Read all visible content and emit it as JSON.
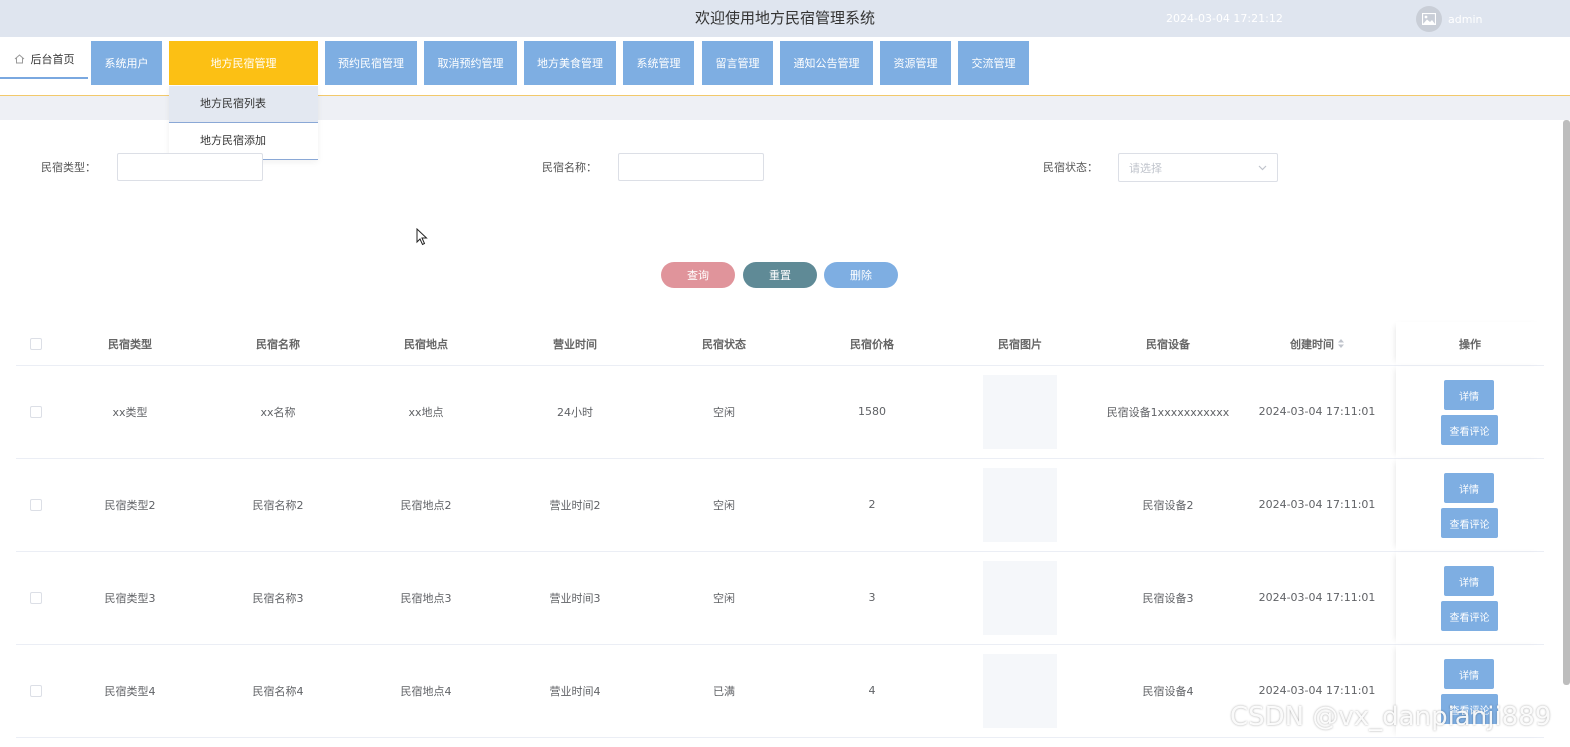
{
  "header": {
    "title": "欢迎使用地方民宿管理系统",
    "datetime": "2024-03-04 17:21:12",
    "username": "admin"
  },
  "nav": {
    "home_label": "后台首页",
    "menus": [
      "系统用户",
      "地方民宿管理",
      "预约民宿管理",
      "取消预约管理",
      "地方美食管理",
      "系统管理",
      "留言管理",
      "通知公告管理",
      "资源管理",
      "交流管理"
    ],
    "active_menu": "地方民宿管理",
    "dropdown": [
      "地方民宿列表",
      "地方民宿添加"
    ]
  },
  "filters": {
    "type_label": "民宿类型：",
    "type_value": "",
    "name_label": "民宿名称：",
    "name_value": "",
    "status_label": "民宿状态：",
    "status_placeholder": "请选择"
  },
  "actions": {
    "query": "查询",
    "reset": "重置",
    "delete": "删除"
  },
  "colors": {
    "header_bg": "#dfe5ef",
    "menu": "#7eaee2",
    "menu_active": "#fcc014",
    "query_btn": "#e0949b",
    "reset_btn": "#5f8a96",
    "delete_btn": "#7eaee2"
  },
  "table": {
    "columns": [
      "民宿类型",
      "民宿名称",
      "民宿地点",
      "营业时间",
      "民宿状态",
      "民宿价格",
      "民宿图片",
      "民宿设备",
      "创建时间",
      "操作"
    ],
    "rows": [
      {
        "type": "xx类型",
        "name": "xx名称",
        "location": "xx地点",
        "hours": "24小时",
        "status": "空闲",
        "price": "1580",
        "equipment": "民宿设备1xxxxxxxxxxx",
        "created": "2024-03-04 17:11:01"
      },
      {
        "type": "民宿类型2",
        "name": "民宿名称2",
        "location": "民宿地点2",
        "hours": "营业时间2",
        "status": "空闲",
        "price": "2",
        "equipment": "民宿设备2",
        "created": "2024-03-04 17:11:01"
      },
      {
        "type": "民宿类型3",
        "name": "民宿名称3",
        "location": "民宿地点3",
        "hours": "营业时间3",
        "status": "空闲",
        "price": "3",
        "equipment": "民宿设备3",
        "created": "2024-03-04 17:11:01"
      },
      {
        "type": "民宿类型4",
        "name": "民宿名称4",
        "location": "民宿地点4",
        "hours": "营业时间4",
        "status": "已满",
        "price": "4",
        "equipment": "民宿设备4",
        "created": "2024-03-04 17:11:01"
      }
    ],
    "detail_label": "详情",
    "comment_label": "查看评论"
  },
  "watermark": "CSDN @vx_danpianji889"
}
